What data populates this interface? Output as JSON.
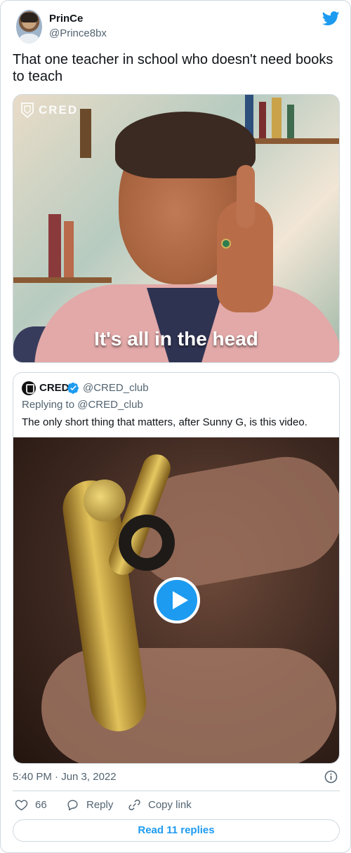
{
  "author": {
    "display_name": "PrinCe",
    "handle": "@Prince8bx"
  },
  "tweet": {
    "text": "That one teacher in school who doesn't need books to teach"
  },
  "media": {
    "brand": "CRED",
    "caption": "It's all in the head"
  },
  "quoted_tweet": {
    "display_name": "CRED",
    "handle": "@CRED_club",
    "replying_to": "Replying to @CRED_club",
    "text": "The only short thing that matters, after Sunny G, is this video."
  },
  "footer": {
    "timestamp": "5:40 PM · Jun 3, 2022",
    "likes": "66",
    "reply_label": "Reply",
    "copy_link_label": "Copy link",
    "read_replies_label": "Read 11 replies"
  },
  "icons": {
    "brand": "twitter-bird-icon",
    "verified": "verified-badge-icon",
    "info": "info-icon",
    "like": "heart-icon",
    "reply": "speech-bubble-icon",
    "copy": "link-icon",
    "play": "play-icon"
  },
  "colors": {
    "accent": "#1d9bf0",
    "text_primary": "#0f1419",
    "text_secondary": "#536471",
    "border": "#cfd9de"
  }
}
